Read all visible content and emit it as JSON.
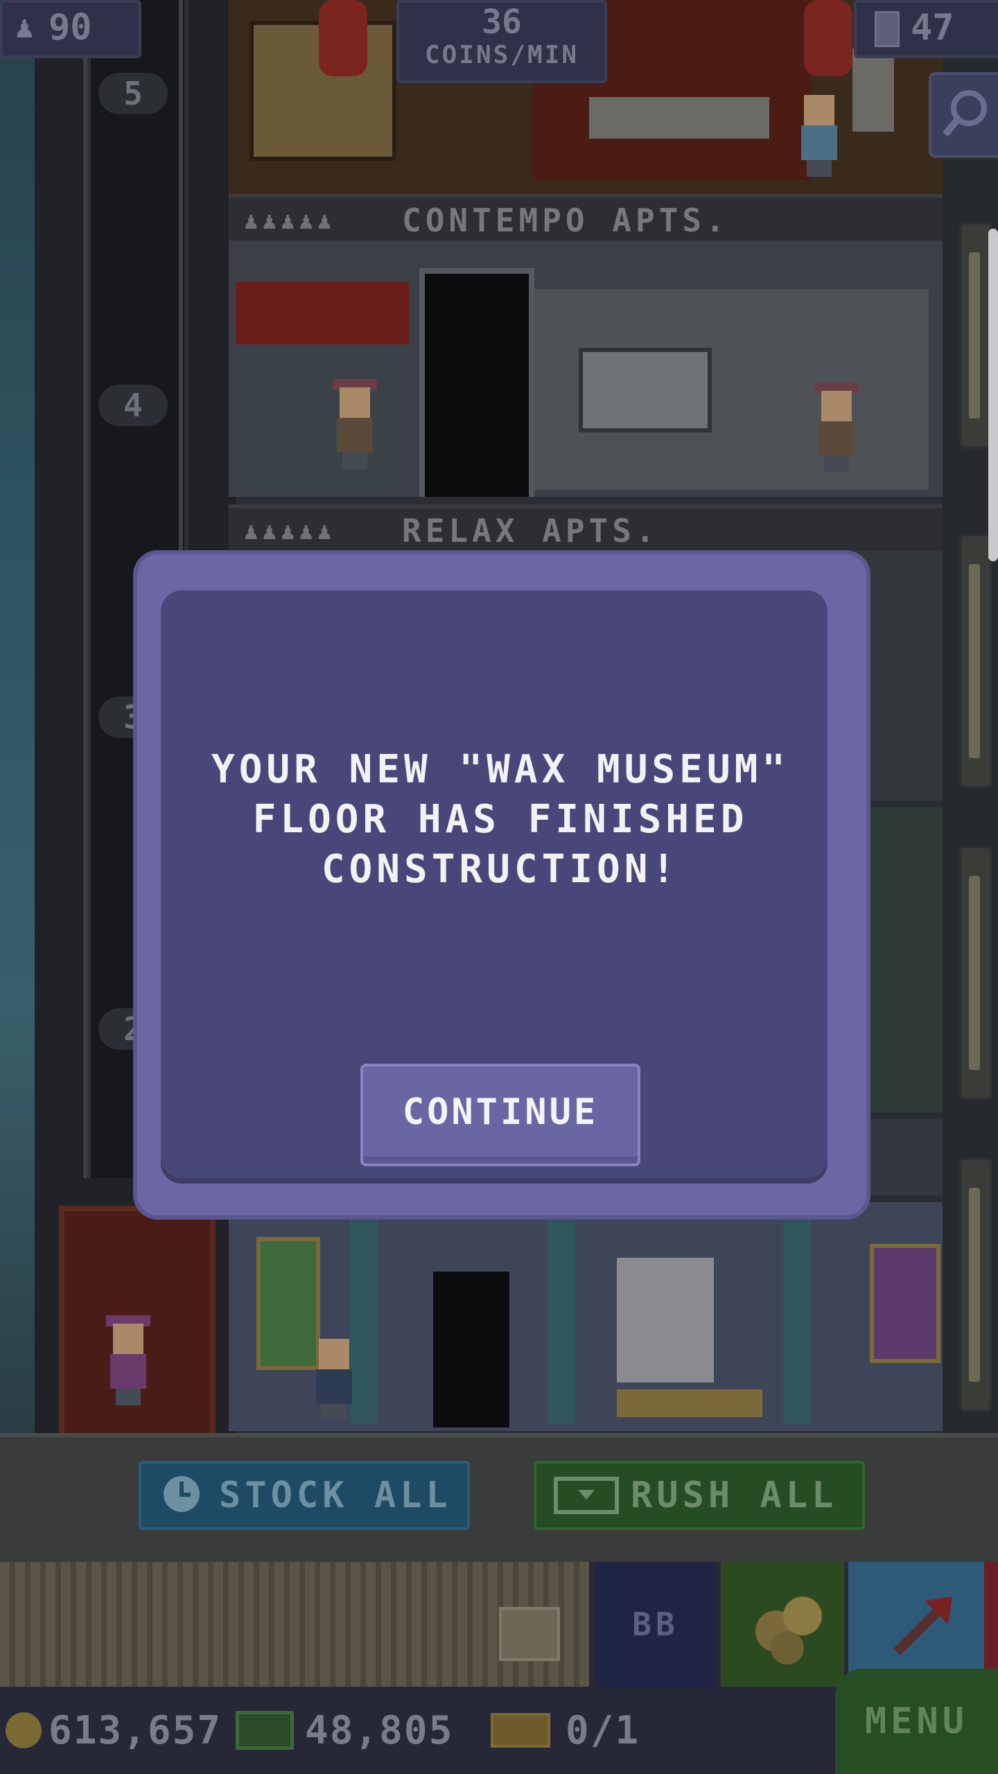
{
  "hud": {
    "population": "90",
    "coins_per_min_value": "36",
    "coins_per_min_label": "COINS/MIN",
    "floors": "47"
  },
  "floors": [
    {
      "name": "CONTEMPO APTS.",
      "occupancy_icons": "♟♟♟♟♟"
    },
    {
      "name": "RELAX APTS.",
      "occupancy_icons": "♟♟♟♟♟"
    }
  ],
  "elevator_floor_numbers": [
    "5",
    "4",
    "3",
    "2"
  ],
  "modal": {
    "message_line1": "YOUR NEW \"WAX MUSEUM\"",
    "message_line2": "FLOOR HAS FINISHED",
    "message_line3": "CONSTRUCTION!",
    "continue_label": "CONTINUE"
  },
  "actions": {
    "stock_all": "STOCK ALL",
    "rush_all": "RUSH ALL"
  },
  "tray": {
    "bb_label": "BB"
  },
  "status": {
    "coins": "613,657",
    "bux": "48,805",
    "tickets": "0/1",
    "menu_label": "MENU"
  },
  "colors": {
    "modal_outer": "#6b67a5",
    "modal_inner": "#494679",
    "stock_button": "#1e4a63",
    "rush_button": "#254c22",
    "menu_button": "#274d25"
  },
  "icons": {
    "population": "person-icon",
    "floors": "building-icon",
    "search": "magnifier-icon",
    "stock": "clock-icon",
    "rush": "bux-icon",
    "coins": "coin-icon",
    "bux": "bux-icon",
    "tickets": "ticket-icon"
  }
}
